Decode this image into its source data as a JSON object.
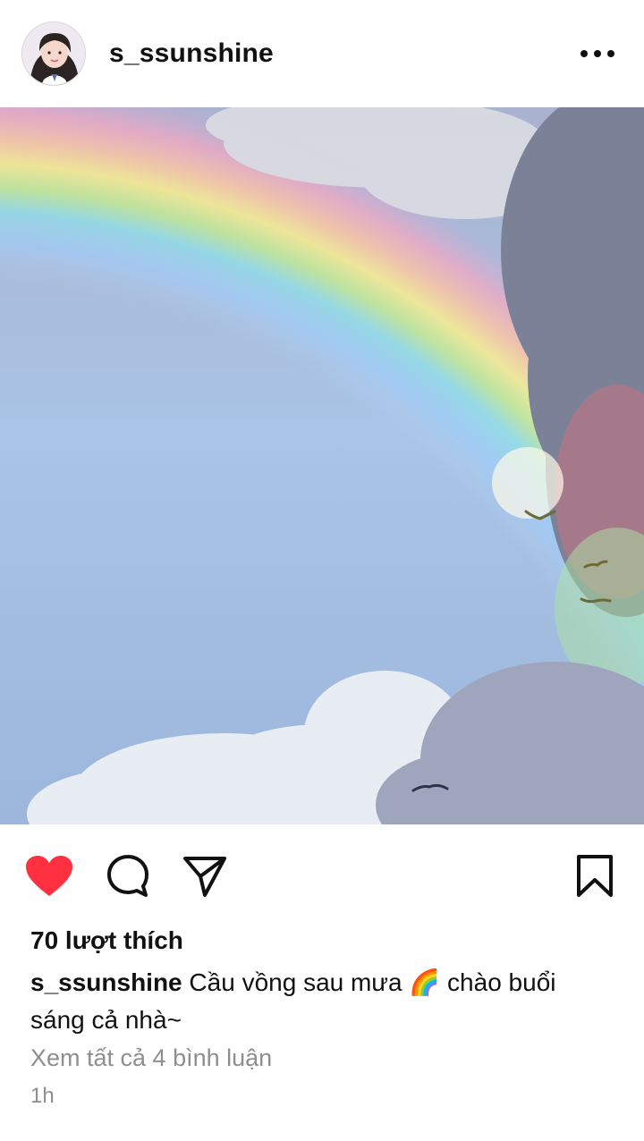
{
  "header": {
    "username": "s_ssunshine",
    "avatar_icon": "profile-photo",
    "more_icon": "more-horizontal-icon"
  },
  "post": {
    "image_description_icon": "rainbow-photo",
    "liked": true,
    "like_color": "#ff3040"
  },
  "actions": {
    "like_icon": "heart-filled-icon",
    "comment_icon": "comment-icon",
    "share_icon": "send-icon",
    "save_icon": "bookmark-icon"
  },
  "likes": {
    "text": "70 lượt thích"
  },
  "caption": {
    "username": "s_ssunshine",
    "text": "Cầu vồng sau mưa 🌈 chào buổi sáng cả nhà~"
  },
  "comments": {
    "view_all": "Xem tất cả 4 bình luận"
  },
  "timestamp": "1h"
}
